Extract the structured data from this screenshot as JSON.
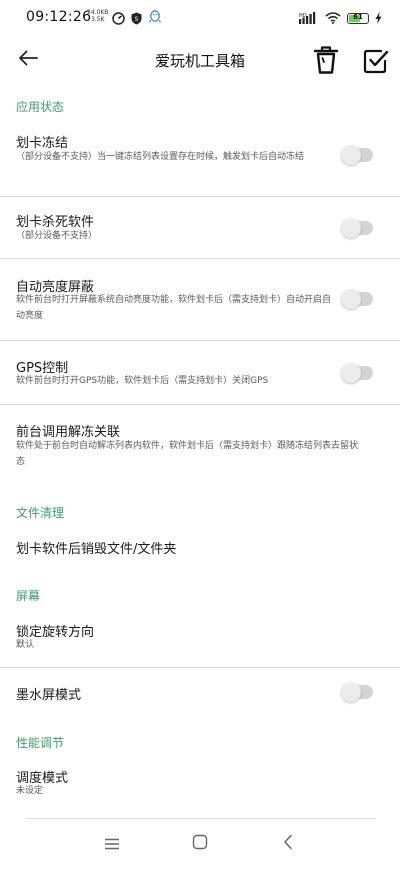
{
  "status_bar": {
    "time": "09:12:26",
    "net_speed_value": "24.0KB",
    "net_speed_unit": "3.5K",
    "battery_level": "61",
    "battery_fraction": 0.61,
    "icons": [
      "speedometer-icon",
      "shield-icon",
      "qq-penguin-icon",
      "hd-signal-icon",
      "wifi-icon",
      "battery-icon",
      "charging-icon"
    ]
  },
  "app_bar": {
    "title": "爱玩机工具箱",
    "icons": [
      "back-arrow-icon",
      "trash-icon",
      "checkbox-icon"
    ]
  },
  "sections": {
    "app_state": {
      "header": "应用状态",
      "freeze": {
        "title": "划卡冻结",
        "subtitle": "（部分设备不支持）当一键冻结列表设置存在时候，触发划卡后自动冻结",
        "enabled": false
      },
      "kill": {
        "title": "划卡杀死软件",
        "subtitle": "（部分设备不支持）",
        "enabled": false
      },
      "brightness": {
        "title": "自动亮度屏蔽",
        "subtitle": "软件前台时打开屏蔽系统自动亮度功能，软件划卡后（需支持划卡）自动开启自动亮度",
        "enabled": false
      },
      "gps": {
        "title": "GPS控制",
        "subtitle": "软件前台时打开GPS功能，软件划卡后（需支持划卡）关闭GPS",
        "enabled": false
      },
      "foreground": {
        "title": "前台调用解冻关联",
        "subtitle": "软件处于前台时自动解冻列表内软件，软件划卡后（需支持划卡）跟随冻结列表去留状态"
      }
    },
    "file_cleanup": {
      "header": "文件清理",
      "destroy": {
        "title": "划卡软件后销毁文件/文件夹"
      }
    },
    "screen": {
      "header": "屏幕",
      "rotation": {
        "title": "锁定旋转方向",
        "value": "默认"
      },
      "eink": {
        "title": "墨水屏模式",
        "enabled": false
      }
    },
    "performance": {
      "header": "性能调节",
      "scheduler": {
        "title": "调度模式",
        "value": "未设定"
      }
    }
  },
  "nav_bar": {
    "icons": [
      "menu-icon",
      "home-icon",
      "back-icon"
    ]
  },
  "colors": {
    "accent": "#3d9e72",
    "toggle_off_track": "#d4d4d4",
    "toggle_off_knob": "#ececec",
    "battery_fill": "#6ecf5a"
  }
}
